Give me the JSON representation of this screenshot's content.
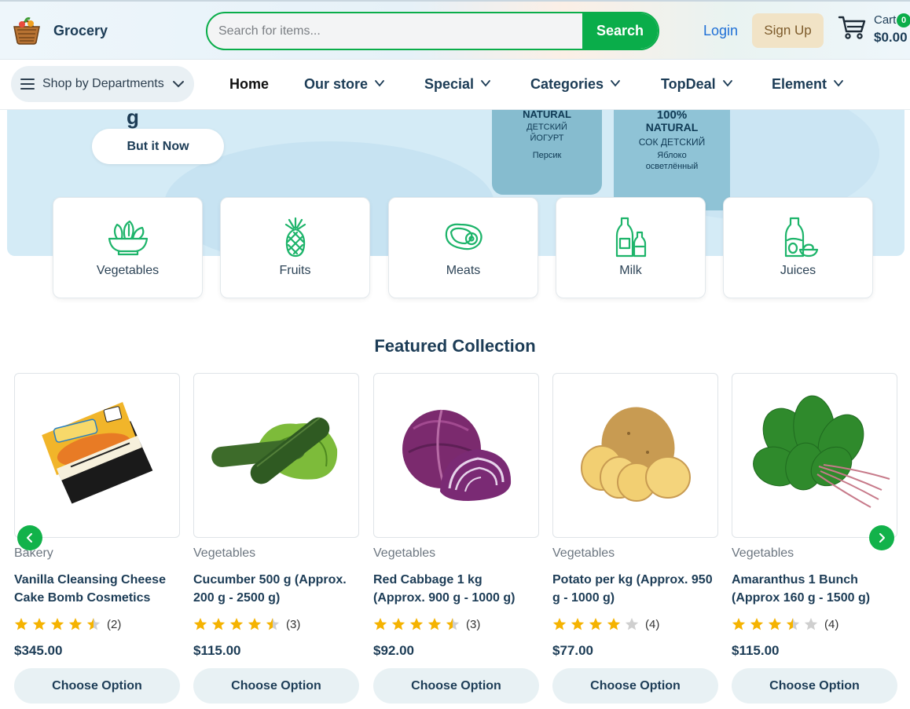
{
  "header": {
    "brand": "Grocery",
    "search_placeholder": "Search for items...",
    "search_button": "Search",
    "login": "Login",
    "signup": "Sign Up",
    "cart_label": "Cart",
    "cart_count": "0",
    "cart_total": "$0.00"
  },
  "nav": {
    "departments": "Shop by Departments",
    "items": [
      "Home",
      "Our store",
      "Special",
      "Categories",
      "TopDeal",
      "Element"
    ]
  },
  "hero": {
    "button": "But it Now",
    "pack1_lines": [
      "NATURAL",
      "ДЕТСКИЙ",
      "ЙОГУРТ",
      "Персик"
    ],
    "pack2_lines": [
      "100%",
      "NATURAL",
      "СОК ДЕТСКИЙ",
      "Яблоко",
      "осветлённый"
    ]
  },
  "categories": [
    "Vegetables",
    "Fruits",
    "Meats",
    "Milk",
    "Juices"
  ],
  "featured": {
    "title": "Featured Collection",
    "products": [
      {
        "category": "Bakery",
        "name": "Vanilla Cleansing Cheese Cake Bomb Cosmetics",
        "rating": 4.5,
        "reviews": "(2)",
        "price": "$345.00",
        "button": "Choose Option"
      },
      {
        "category": "Vegetables",
        "name": "Cucumber 500 g (Approx. 200 g - 2500 g)",
        "rating": 4.5,
        "reviews": "(3)",
        "price": "$115.00",
        "button": "Choose Option"
      },
      {
        "category": "Vegetables",
        "name": "Red Cabbage 1 kg (Approx. 900 g - 1000 g)",
        "rating": 4.5,
        "reviews": "(3)",
        "price": "$92.00",
        "button": "Choose Option"
      },
      {
        "category": "Vegetables",
        "name": "Potato per kg (Approx. 950 g - 1000 g)",
        "rating": 4,
        "reviews": "(4)",
        "price": "$77.00",
        "button": "Choose Option"
      },
      {
        "category": "Vegetables",
        "name": "Amaranthus 1 Bunch (Approx 160 g - 1500 g)",
        "rating": 3.5,
        "reviews": "(4)",
        "price": "$115.00",
        "button": "Choose Option"
      }
    ]
  },
  "colors": {
    "accent_green": "#0aad4a",
    "navy_text": "#1c3c56",
    "star_gold": "#f5b301",
    "link_blue": "#1e6fd6"
  }
}
